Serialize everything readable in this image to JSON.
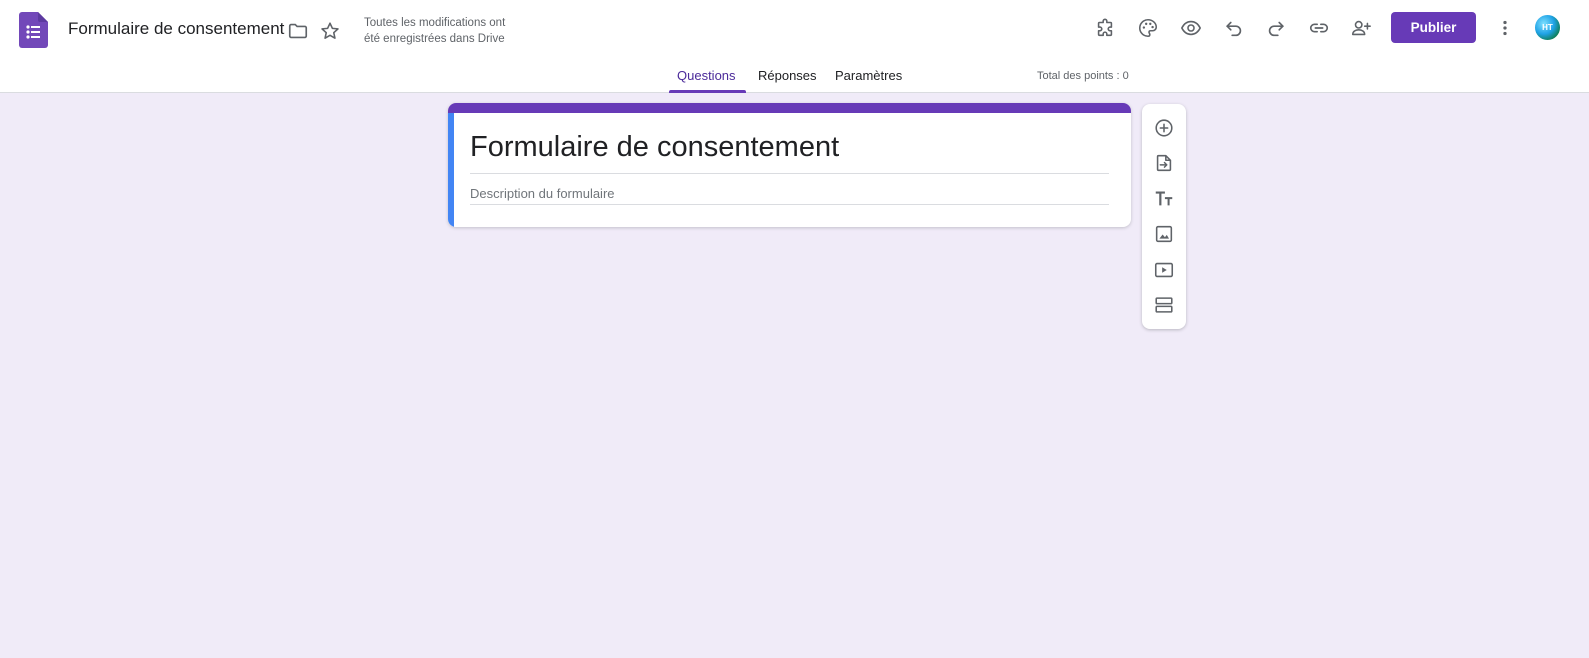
{
  "header": {
    "doc_title": "Formulaire de consentement",
    "save_status_line1": "Toutes les modifications ont",
    "save_status_line2": "été enregistrées dans Drive",
    "publish_label": "Publier",
    "avatar_initials": "HT"
  },
  "icons": {
    "app": "google-forms-icon",
    "folder": "folder-icon",
    "star": "star-icon",
    "addons": "puzzle-icon",
    "theme": "palette-icon",
    "preview": "eye-icon",
    "undo": "undo-icon",
    "redo": "redo-icon",
    "link": "link-icon",
    "collaborators": "person-add-icon",
    "more": "more-vert-icon"
  },
  "tabs": [
    {
      "label": "Questions",
      "active": true
    },
    {
      "label": "Réponses",
      "active": false
    },
    {
      "label": "Paramètres",
      "active": false
    }
  ],
  "total_points": "Total des points : 0",
  "form": {
    "title": "Formulaire de consentement",
    "description_placeholder": "Description du formulaire"
  },
  "toolbar": [
    "add-question-icon",
    "import-questions-icon",
    "add-title-description-icon",
    "add-image-icon",
    "add-video-icon",
    "add-section-icon"
  ],
  "colors": {
    "accent": "#673ab7",
    "background": "#f0ebf8",
    "card_left_accent": "#4285f4",
    "icon": "#5f6368"
  }
}
